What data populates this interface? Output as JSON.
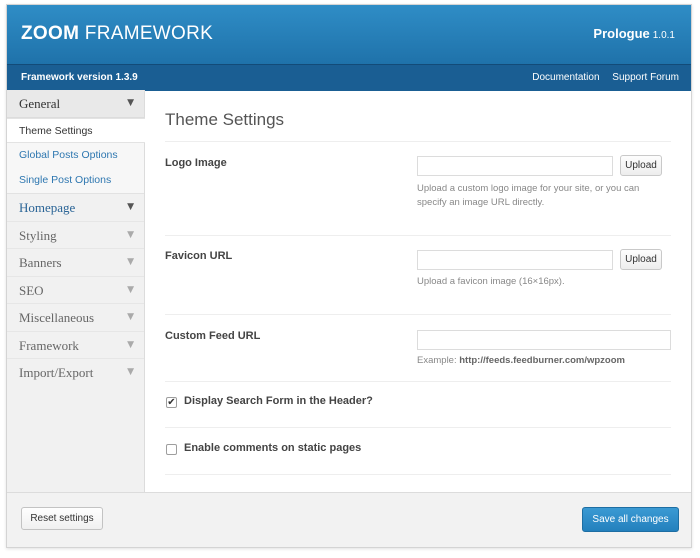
{
  "header": {
    "logo_bold": "ZOOM",
    "logo_light": "FRAMEWORK",
    "theme_name": "Prologue",
    "theme_version": "1.0.1",
    "framework_version": "Framework version 1.3.9",
    "links": [
      "Documentation",
      "Support Forum"
    ]
  },
  "sidebar": {
    "general": "General",
    "subitems": [
      "Theme Settings",
      "Global Posts Options",
      "Single Post Options"
    ],
    "items": [
      "Homepage",
      "Styling",
      "Banners",
      "SEO",
      "Miscellaneous",
      "Framework",
      "Import/Export"
    ],
    "arrow": "▼"
  },
  "main": {
    "title": "Theme Settings",
    "logo_image": {
      "label": "Logo Image",
      "value": "",
      "button": "Upload",
      "help": "Upload a custom logo image for your site, or you can specify an image URL directly."
    },
    "favicon": {
      "label": "Favicon URL",
      "value": "",
      "button": "Upload",
      "help": "Upload a favicon image (16×16px)."
    },
    "feed": {
      "label": "Custom Feed URL",
      "value": "",
      "help_prefix": "Example:",
      "help_url": "http://feeds.feedburner.com/wpzoom"
    },
    "search_form": {
      "label": "Display Search Form in the Header?",
      "checked": true,
      "mark": "✔"
    },
    "comments": {
      "label": "Enable comments on static pages",
      "checked": false,
      "mark": ""
    }
  },
  "footer": {
    "reset": "Reset settings",
    "save": "Save all changes"
  }
}
